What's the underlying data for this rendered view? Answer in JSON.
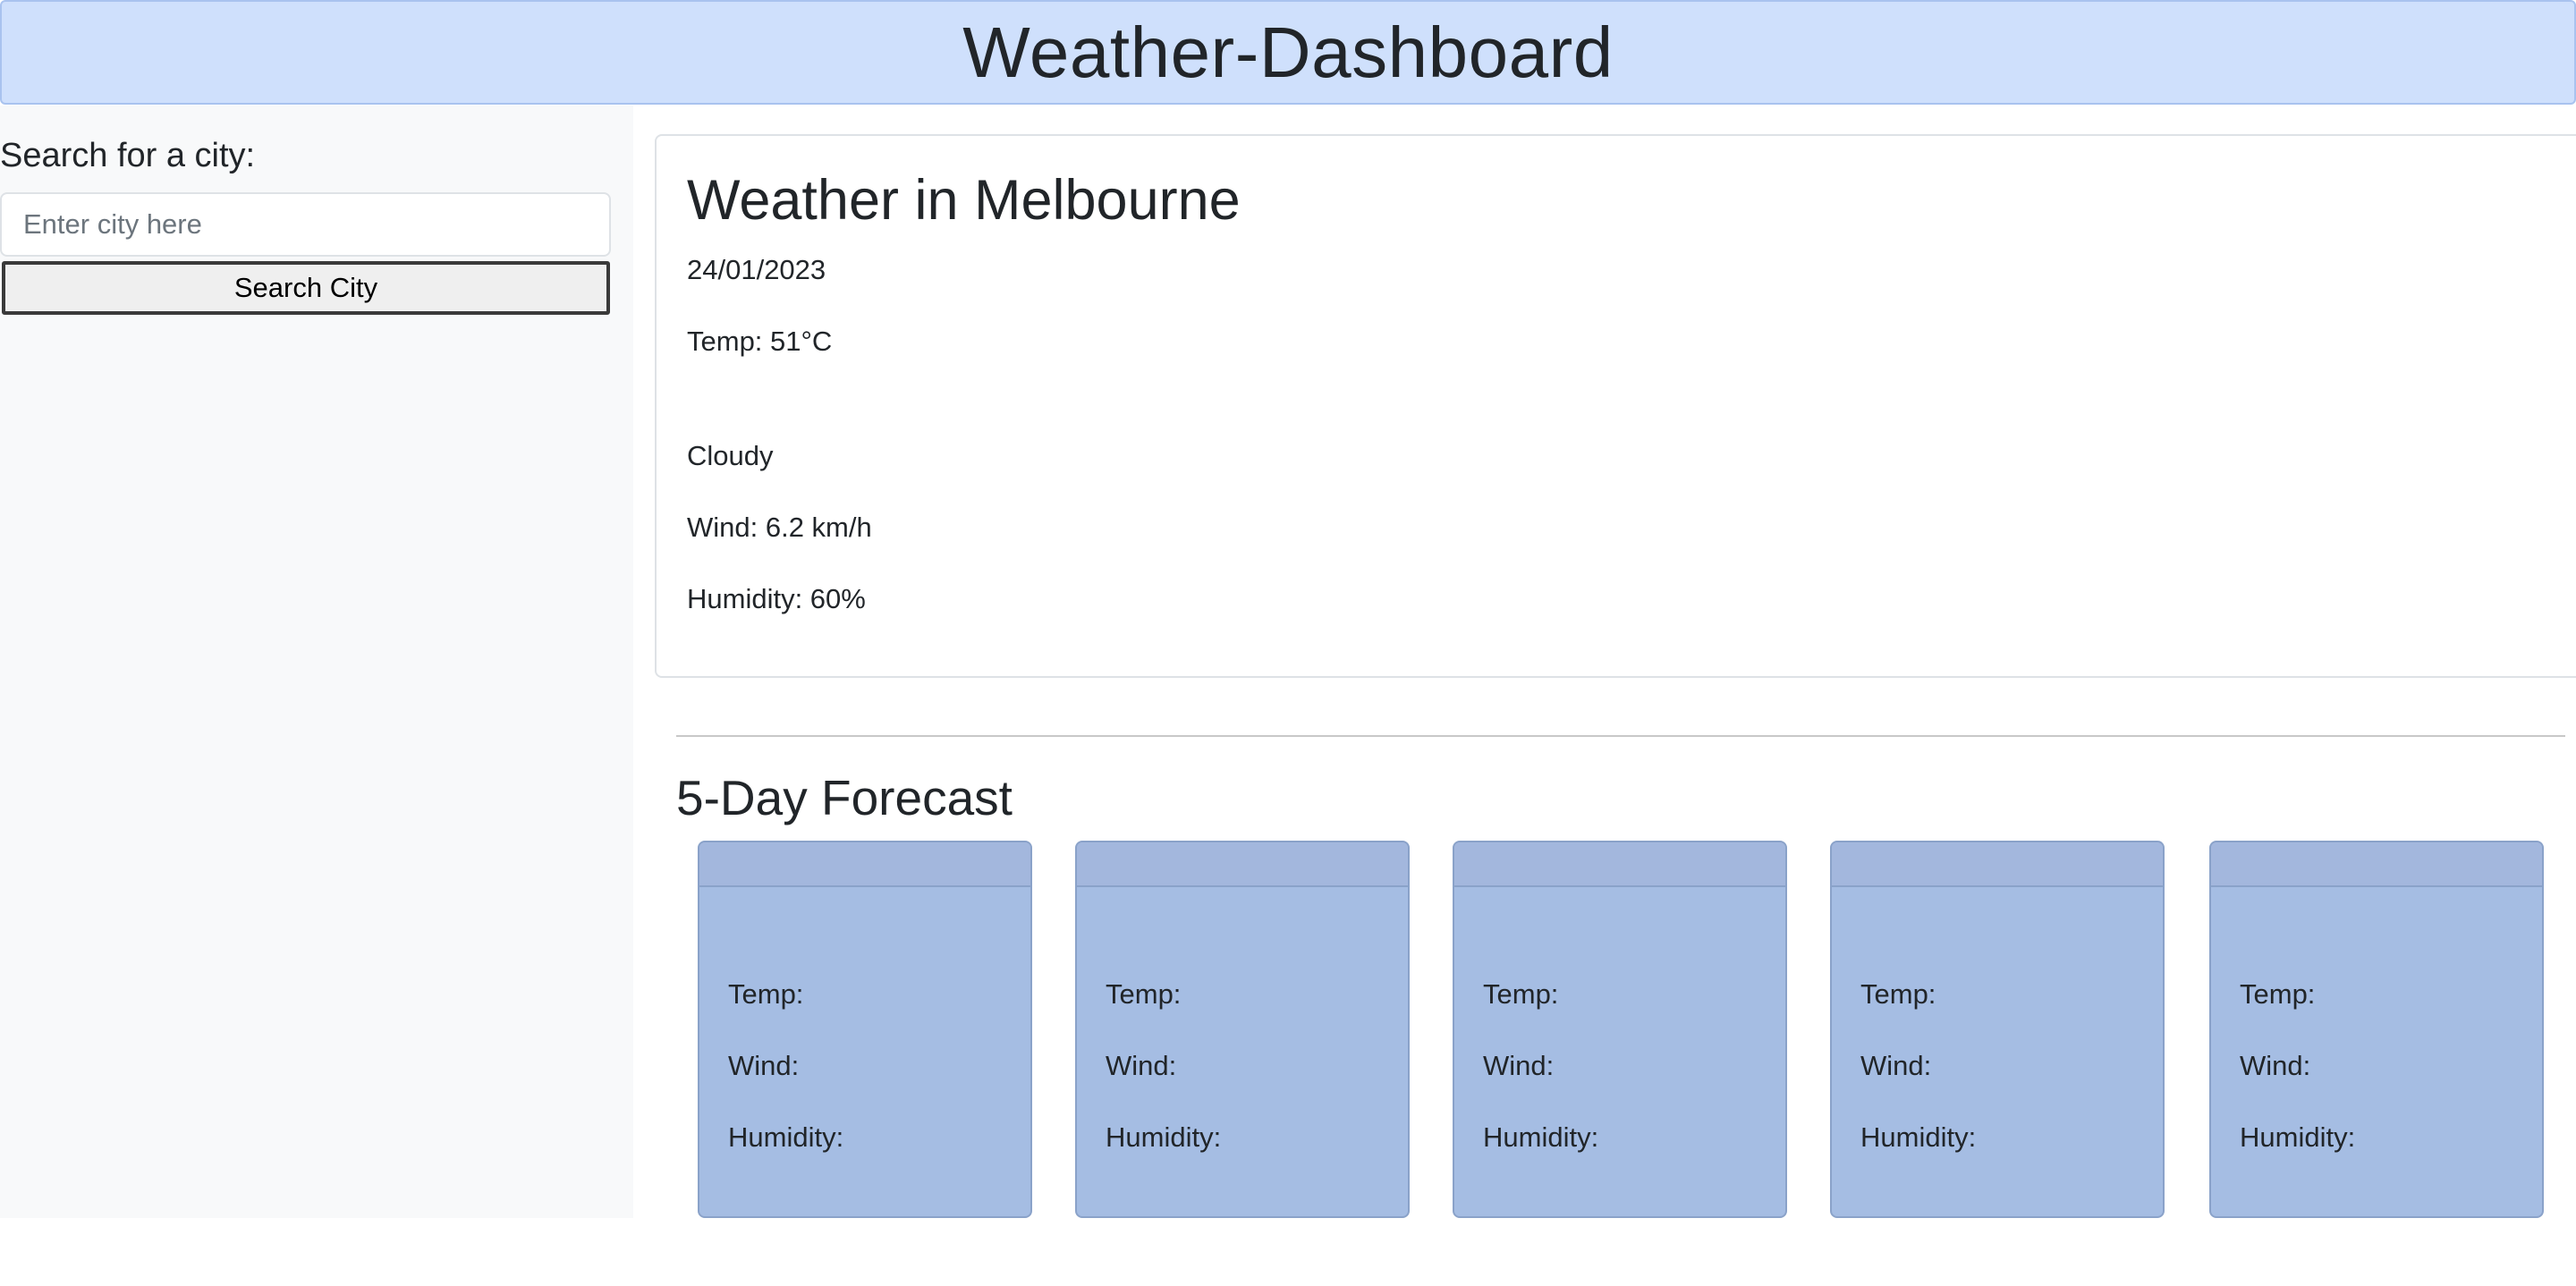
{
  "header": {
    "title": "Weather-Dashboard"
  },
  "sidebar": {
    "label": "Search for a city:",
    "search_placeholder": "Enter city here",
    "search_value": "",
    "search_button": "Search City"
  },
  "current": {
    "title": "Weather in Melbourne",
    "date": "24/01/2023",
    "temp": "Temp: 51°C",
    "condition": "Cloudy",
    "wind": "Wind: 6.2 km/h",
    "humidity": "Humidity: 60%"
  },
  "forecast": {
    "title": "5-Day Forecast",
    "days": [
      {
        "temp": "Temp:",
        "wind": "Wind:",
        "humidity": "Humidity:"
      },
      {
        "temp": "Temp:",
        "wind": "Wind:",
        "humidity": "Humidity:"
      },
      {
        "temp": "Temp:",
        "wind": "Wind:",
        "humidity": "Humidity:"
      },
      {
        "temp": "Temp:",
        "wind": "Wind:",
        "humidity": "Humidity:"
      },
      {
        "temp": "Temp:",
        "wind": "Wind:",
        "humidity": "Humidity:"
      }
    ]
  },
  "colors": {
    "header_bg": "#cfe0fc",
    "sidebar_bg": "#f8f9fa",
    "forecast_card_bg": "#a5bde3"
  }
}
